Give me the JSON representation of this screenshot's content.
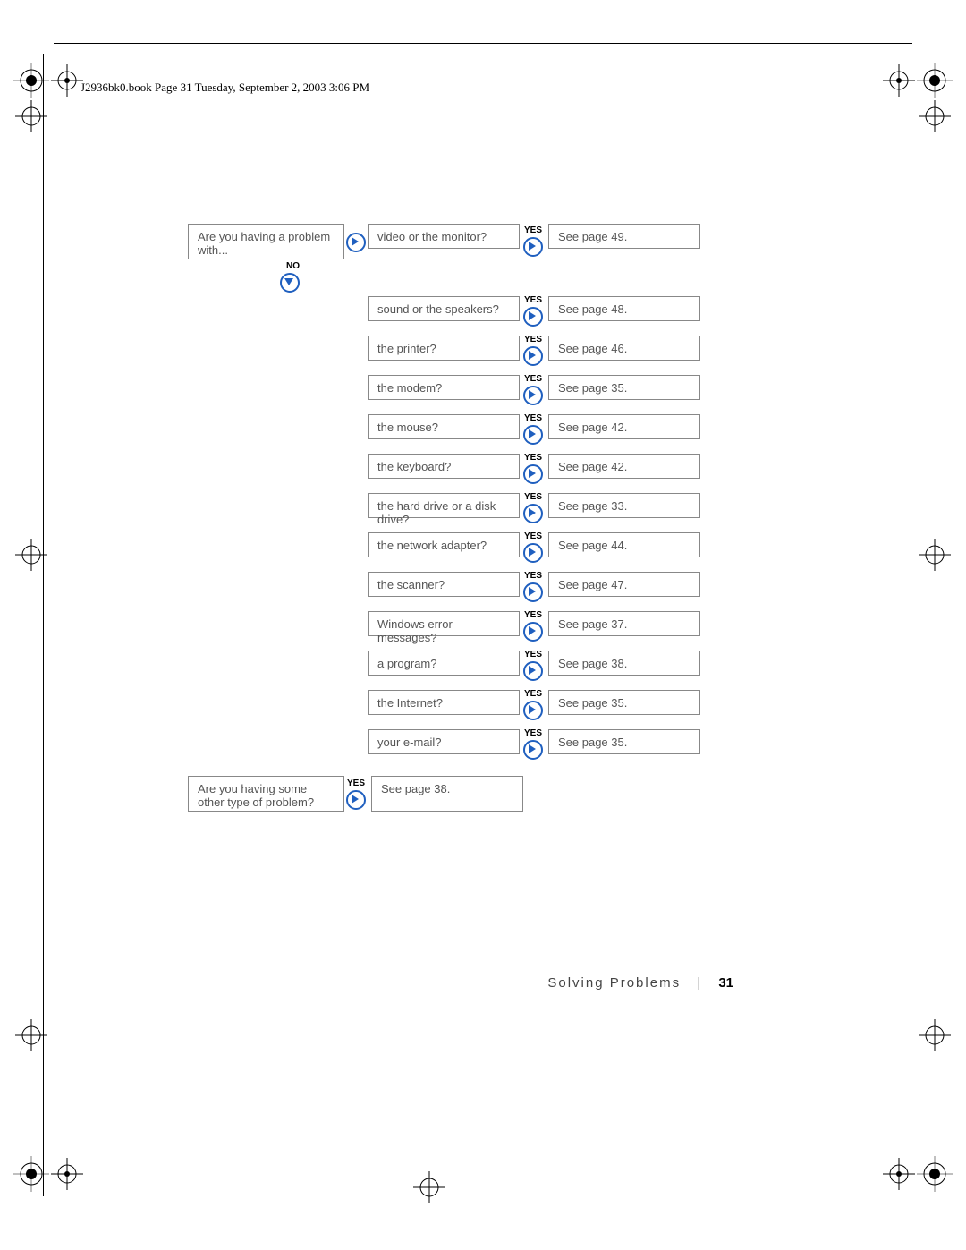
{
  "header": "J2936bk0.book  Page 31  Tuesday, September 2, 2003  3:06 PM",
  "q1": "Are you having a problem with...",
  "no_label": "NO",
  "yes_label": "YES",
  "items": [
    {
      "q": "video or the monitor?",
      "a": "See page 49."
    },
    {
      "q": "sound or the speakers?",
      "a": "See page 48."
    },
    {
      "q": "the printer?",
      "a": "See page 46."
    },
    {
      "q": "the modem?",
      "a": "See page 35."
    },
    {
      "q": "the mouse?",
      "a": "See page 42."
    },
    {
      "q": "the keyboard?",
      "a": "See page 42."
    },
    {
      "q": "the hard drive or a disk drive?",
      "a": "See page 33."
    },
    {
      "q": "the network adapter?",
      "a": "See page 44."
    },
    {
      "q": "the scanner?",
      "a": "See page 47."
    },
    {
      "q": "Windows error messages?",
      "a": "See page 37."
    },
    {
      "q": "a program?",
      "a": "See page 38."
    },
    {
      "q": "the Internet?",
      "a": "See page 35."
    },
    {
      "q": "your e-mail?",
      "a": "See page 35."
    }
  ],
  "q2": "Are you having some other type of problem?",
  "a2": "See page 38.",
  "footer_section": "Solving Problems",
  "footer_page": "31"
}
